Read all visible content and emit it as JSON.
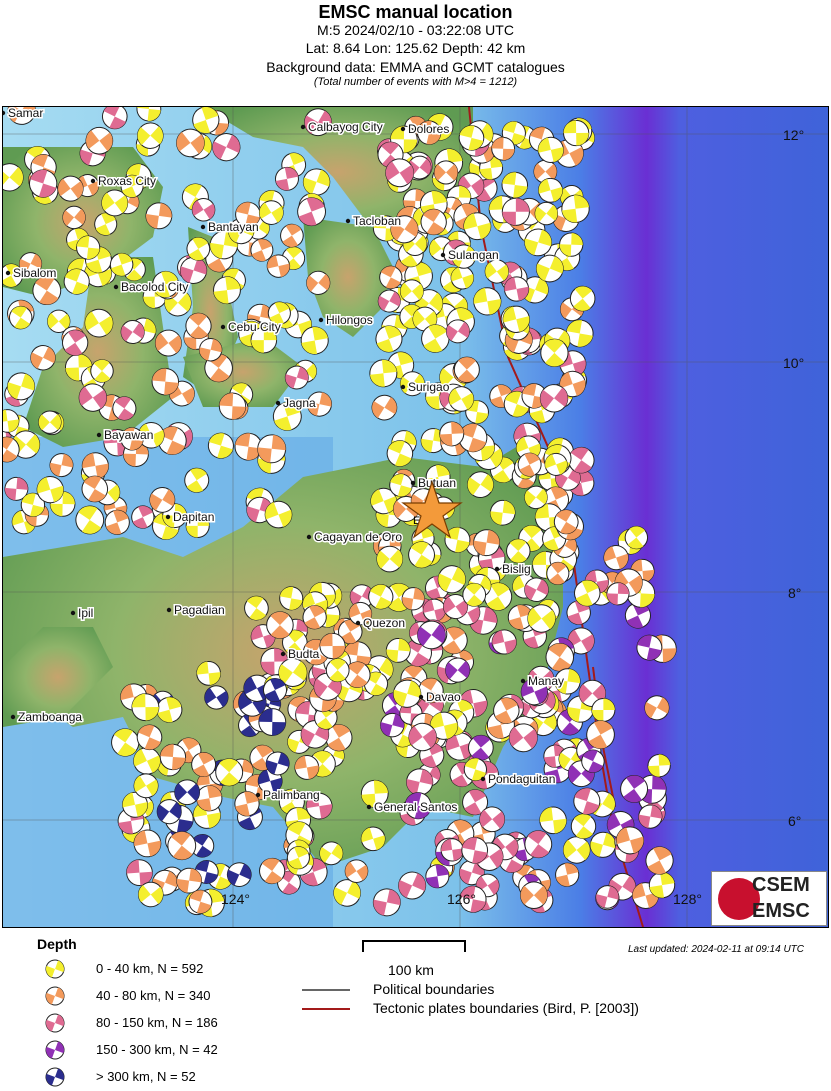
{
  "header": {
    "title": "EMSC manual location",
    "line1": "M:5 2024/02/10 - 03:22:08 UTC",
    "line2": "Lat: 8.64 Lon: 125.62 Depth: 42 km",
    "line3": "Background data: EMMA and GCMT catalogues",
    "line4": "(Total number of events with M>4 = 1212)"
  },
  "map": {
    "cities": [
      "Samar",
      "Calbayog City",
      "Dolores",
      "Roxas City",
      "Bantayan",
      "Tacloban",
      "Sulangan",
      "Sibalom",
      "Bacolod City",
      "Hilongos",
      "Cebu City",
      "Surigao",
      "Jagna",
      "Bayawan",
      "Butuan",
      "Dapitan",
      "EMSC",
      "Cagayan de Oro",
      "Bislig",
      "Ipil",
      "Pagadian",
      "Quezon",
      "Budta",
      "Davao",
      "Manay",
      "Zamboanga",
      "Pondaguitan",
      "Palimbang",
      "General Santos"
    ],
    "lat_labels": [
      "12°",
      "10°",
      "8°",
      "6°"
    ],
    "lon_labels": [
      "124°",
      "126°",
      "128°"
    ],
    "colors": {
      "sea_shallow": "#9fd6ee",
      "sea_deep": "#3a62d8",
      "trench": "#7a1fd0",
      "land": "#6fa25a",
      "mountain": "#b99b6a",
      "plate_boundary": "#a31a1a",
      "political_boundary": "#666666",
      "star": "#f39a3a"
    }
  },
  "legend": {
    "title": "Depth",
    "items": [
      {
        "label": "0 - 40 km, N = 592",
        "color": "#f4ef2e"
      },
      {
        "label": "40 - 80 km, N = 340",
        "color": "#f39a5c"
      },
      {
        "label": "80 - 150 km, N = 186",
        "color": "#df6b92"
      },
      {
        "label": "150 - 300 km, N = 42",
        "color": "#9031b5"
      },
      {
        "label": "> 300 km, N = 52",
        "color": "#2b2d8e"
      }
    ],
    "scale_label": "100 km",
    "boundaries": [
      {
        "label": "Political boundaries",
        "color": "#666666"
      },
      {
        "label": "Tectonic plates boundaries (Bird, P. [2003])",
        "color": "#a31a1a"
      }
    ]
  },
  "footer": {
    "updated": "Last updated: 2024-02-11 at 09:14 UTC",
    "logo_line1": "CSEM",
    "logo_line2": "EMSC"
  }
}
